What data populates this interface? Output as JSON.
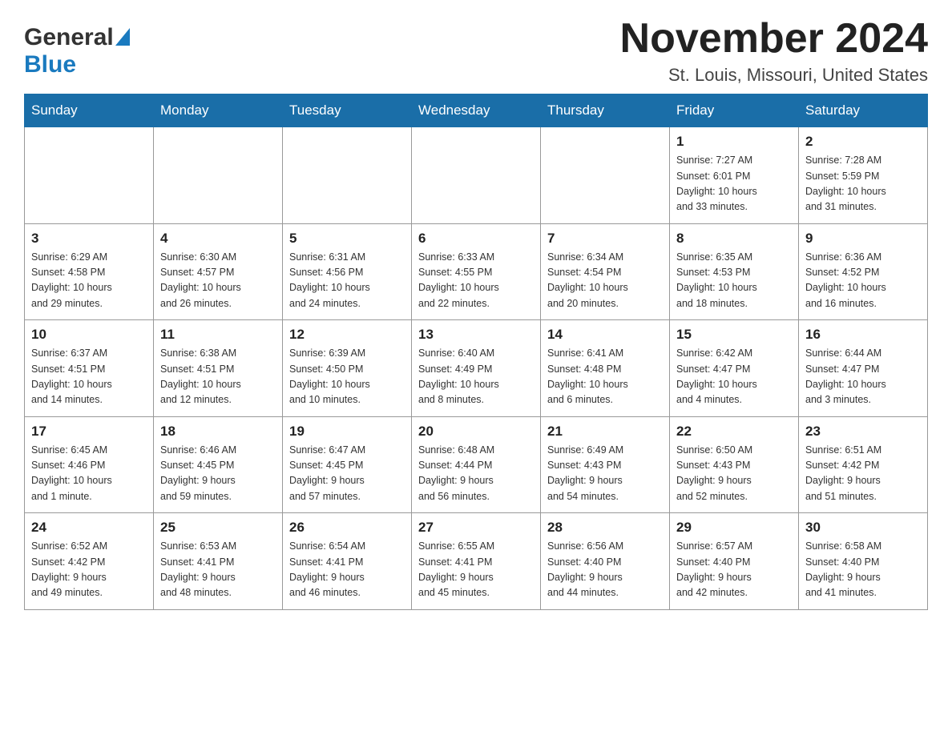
{
  "header": {
    "logo_general": "General",
    "logo_blue": "Blue",
    "month_title": "November 2024",
    "location": "St. Louis, Missouri, United States"
  },
  "weekdays": [
    "Sunday",
    "Monday",
    "Tuesday",
    "Wednesday",
    "Thursday",
    "Friday",
    "Saturday"
  ],
  "weeks": [
    [
      {
        "day": "",
        "info": ""
      },
      {
        "day": "",
        "info": ""
      },
      {
        "day": "",
        "info": ""
      },
      {
        "day": "",
        "info": ""
      },
      {
        "day": "",
        "info": ""
      },
      {
        "day": "1",
        "info": "Sunrise: 7:27 AM\nSunset: 6:01 PM\nDaylight: 10 hours\nand 33 minutes."
      },
      {
        "day": "2",
        "info": "Sunrise: 7:28 AM\nSunset: 5:59 PM\nDaylight: 10 hours\nand 31 minutes."
      }
    ],
    [
      {
        "day": "3",
        "info": "Sunrise: 6:29 AM\nSunset: 4:58 PM\nDaylight: 10 hours\nand 29 minutes."
      },
      {
        "day": "4",
        "info": "Sunrise: 6:30 AM\nSunset: 4:57 PM\nDaylight: 10 hours\nand 26 minutes."
      },
      {
        "day": "5",
        "info": "Sunrise: 6:31 AM\nSunset: 4:56 PM\nDaylight: 10 hours\nand 24 minutes."
      },
      {
        "day": "6",
        "info": "Sunrise: 6:33 AM\nSunset: 4:55 PM\nDaylight: 10 hours\nand 22 minutes."
      },
      {
        "day": "7",
        "info": "Sunrise: 6:34 AM\nSunset: 4:54 PM\nDaylight: 10 hours\nand 20 minutes."
      },
      {
        "day": "8",
        "info": "Sunrise: 6:35 AM\nSunset: 4:53 PM\nDaylight: 10 hours\nand 18 minutes."
      },
      {
        "day": "9",
        "info": "Sunrise: 6:36 AM\nSunset: 4:52 PM\nDaylight: 10 hours\nand 16 minutes."
      }
    ],
    [
      {
        "day": "10",
        "info": "Sunrise: 6:37 AM\nSunset: 4:51 PM\nDaylight: 10 hours\nand 14 minutes."
      },
      {
        "day": "11",
        "info": "Sunrise: 6:38 AM\nSunset: 4:51 PM\nDaylight: 10 hours\nand 12 minutes."
      },
      {
        "day": "12",
        "info": "Sunrise: 6:39 AM\nSunset: 4:50 PM\nDaylight: 10 hours\nand 10 minutes."
      },
      {
        "day": "13",
        "info": "Sunrise: 6:40 AM\nSunset: 4:49 PM\nDaylight: 10 hours\nand 8 minutes."
      },
      {
        "day": "14",
        "info": "Sunrise: 6:41 AM\nSunset: 4:48 PM\nDaylight: 10 hours\nand 6 minutes."
      },
      {
        "day": "15",
        "info": "Sunrise: 6:42 AM\nSunset: 4:47 PM\nDaylight: 10 hours\nand 4 minutes."
      },
      {
        "day": "16",
        "info": "Sunrise: 6:44 AM\nSunset: 4:47 PM\nDaylight: 10 hours\nand 3 minutes."
      }
    ],
    [
      {
        "day": "17",
        "info": "Sunrise: 6:45 AM\nSunset: 4:46 PM\nDaylight: 10 hours\nand 1 minute."
      },
      {
        "day": "18",
        "info": "Sunrise: 6:46 AM\nSunset: 4:45 PM\nDaylight: 9 hours\nand 59 minutes."
      },
      {
        "day": "19",
        "info": "Sunrise: 6:47 AM\nSunset: 4:45 PM\nDaylight: 9 hours\nand 57 minutes."
      },
      {
        "day": "20",
        "info": "Sunrise: 6:48 AM\nSunset: 4:44 PM\nDaylight: 9 hours\nand 56 minutes."
      },
      {
        "day": "21",
        "info": "Sunrise: 6:49 AM\nSunset: 4:43 PM\nDaylight: 9 hours\nand 54 minutes."
      },
      {
        "day": "22",
        "info": "Sunrise: 6:50 AM\nSunset: 4:43 PM\nDaylight: 9 hours\nand 52 minutes."
      },
      {
        "day": "23",
        "info": "Sunrise: 6:51 AM\nSunset: 4:42 PM\nDaylight: 9 hours\nand 51 minutes."
      }
    ],
    [
      {
        "day": "24",
        "info": "Sunrise: 6:52 AM\nSunset: 4:42 PM\nDaylight: 9 hours\nand 49 minutes."
      },
      {
        "day": "25",
        "info": "Sunrise: 6:53 AM\nSunset: 4:41 PM\nDaylight: 9 hours\nand 48 minutes."
      },
      {
        "day": "26",
        "info": "Sunrise: 6:54 AM\nSunset: 4:41 PM\nDaylight: 9 hours\nand 46 minutes."
      },
      {
        "day": "27",
        "info": "Sunrise: 6:55 AM\nSunset: 4:41 PM\nDaylight: 9 hours\nand 45 minutes."
      },
      {
        "day": "28",
        "info": "Sunrise: 6:56 AM\nSunset: 4:40 PM\nDaylight: 9 hours\nand 44 minutes."
      },
      {
        "day": "29",
        "info": "Sunrise: 6:57 AM\nSunset: 4:40 PM\nDaylight: 9 hours\nand 42 minutes."
      },
      {
        "day": "30",
        "info": "Sunrise: 6:58 AM\nSunset: 4:40 PM\nDaylight: 9 hours\nand 41 minutes."
      }
    ]
  ]
}
